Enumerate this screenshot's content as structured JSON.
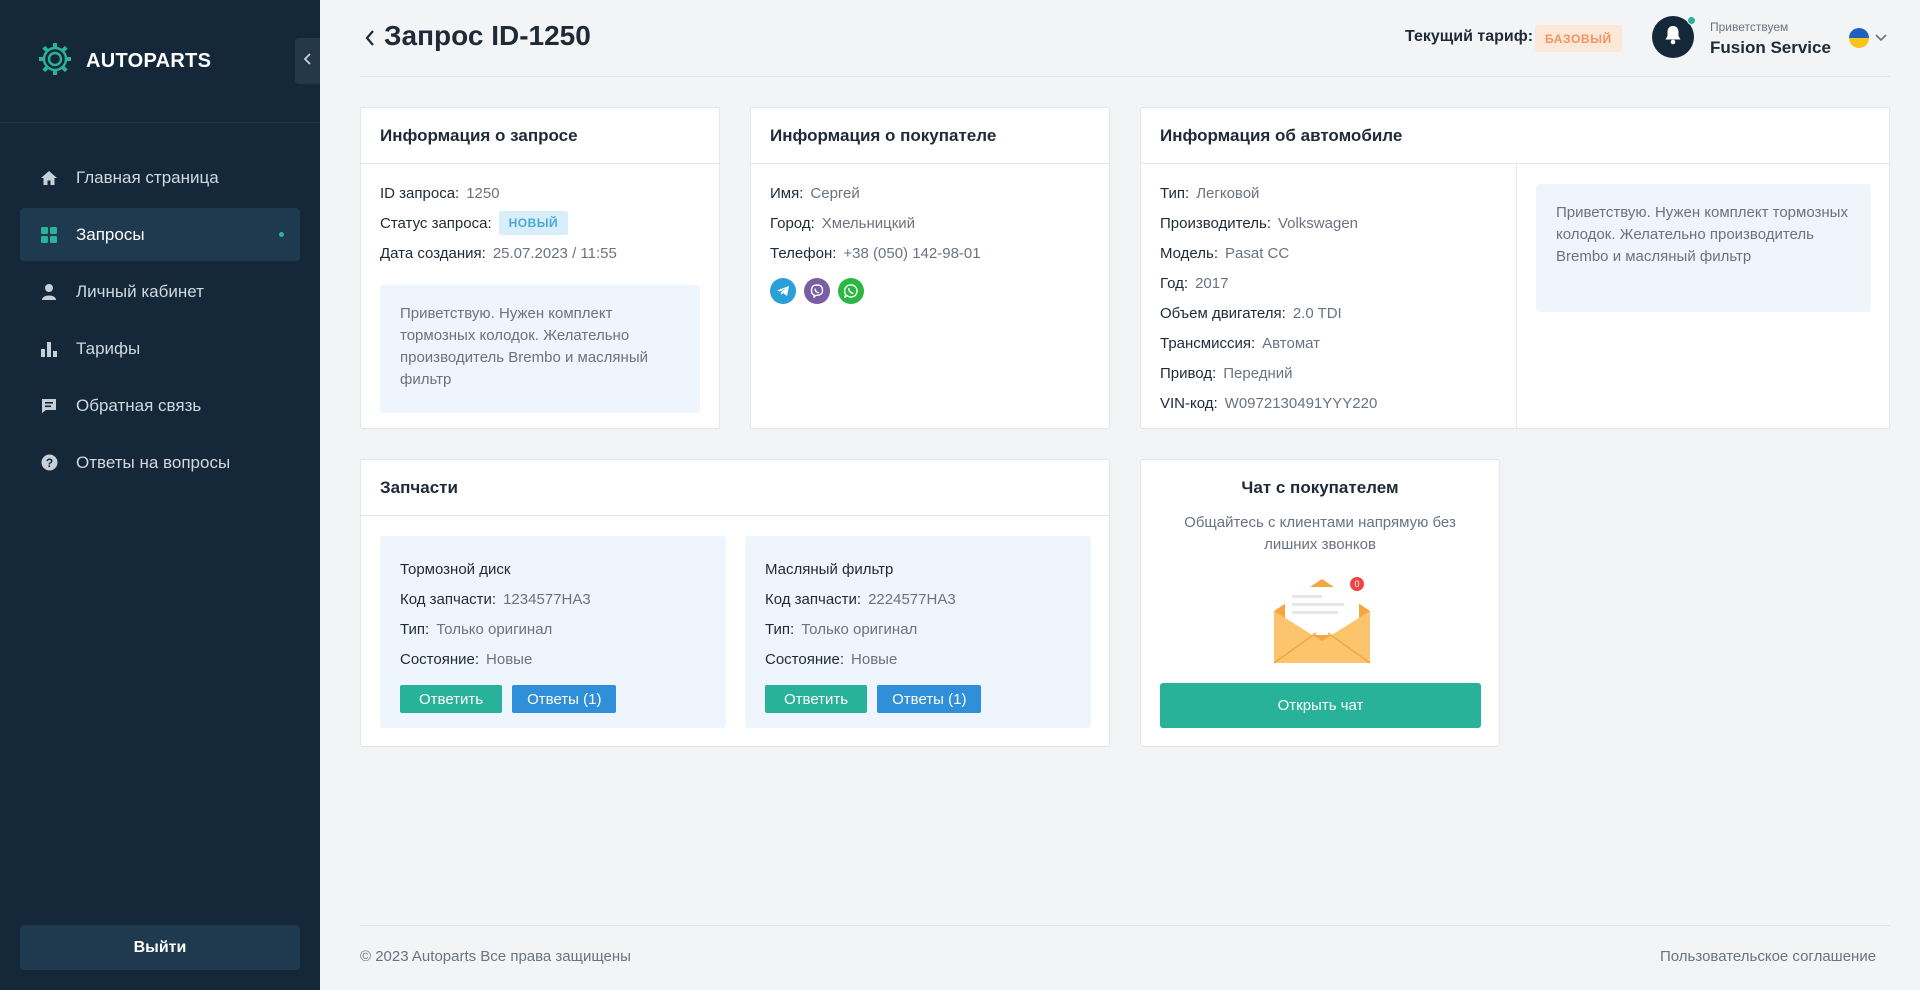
{
  "brand": {
    "name": "AUTOPARTS"
  },
  "sidebar": {
    "items": [
      {
        "label": "Главная страница",
        "icon": "home-icon"
      },
      {
        "label": "Запросы",
        "icon": "grid-icon",
        "active": true
      },
      {
        "label": "Личный кабинет",
        "icon": "user-icon"
      },
      {
        "label": "Тарифы",
        "icon": "bar-chart-icon"
      },
      {
        "label": "Обратная связь",
        "icon": "chat-icon"
      },
      {
        "label": "Ответы на вопросы",
        "icon": "question-icon"
      }
    ],
    "logout_label": "Выйти"
  },
  "header": {
    "title": "Запрос ID-1250",
    "tariff_label": "Текущий тариф:",
    "tariff_value": "БАЗОВЫЙ",
    "greeting": "Приветствуем",
    "user_name": "Fusion Service"
  },
  "request_info": {
    "title": "Информация о запросе",
    "id_label": "ID запроса:",
    "id_value": "1250",
    "status_label": "Статус запроса:",
    "status_value": "НОВЫЙ",
    "date_label": "Дата создания:",
    "date_value": "25.07.2023 / 11:55",
    "note": "Приветствую. Нужен комплект тормозных колодок. Желательно производитель Brembo и масляный фильтр"
  },
  "buyer_info": {
    "title": "Информация о покупателе",
    "name_label": "Имя:",
    "name_value": "Сергей",
    "city_label": "Город:",
    "city_value": "Хмельницкий",
    "phone_label": "Телефон:",
    "phone_value": "+38 (050) 142-98-01"
  },
  "car_info": {
    "title": "Информация об автомобиле",
    "rows": [
      {
        "label": "Тип:",
        "value": "Легковой"
      },
      {
        "label": "Производитель:",
        "value": "Volkswagen"
      },
      {
        "label": "Модель:",
        "value": "Pasat CC"
      },
      {
        "label": "Год:",
        "value": "2017"
      },
      {
        "label": "Объем двигателя:",
        "value": "2.0 TDI"
      },
      {
        "label": "Трансмиссия:",
        "value": "Автомат"
      },
      {
        "label": "Привод:",
        "value": "Передний"
      },
      {
        "label": "VIN-код:",
        "value": "W0972130491YYY220"
      }
    ],
    "note": "Приветствую. Нужен комплект тормозных колодок. Желательно производитель Brembo и масляный фильтр"
  },
  "parts": {
    "title": "Запчасти",
    "items": [
      {
        "name": "Тормозной диск",
        "code_label": "Код запчасти:",
        "code": "1234577HA3",
        "type_label": "Тип:",
        "type": "Только оригинал",
        "state_label": "Состояние:",
        "state": "Новые",
        "reply_label": "Ответить",
        "answers_label": "Ответы (1)"
      },
      {
        "name": "Масляный фильтр",
        "code_label": "Код запчасти:",
        "code": "2224577HA3",
        "type_label": "Тип:",
        "type": "Только оригинал",
        "state_label": "Состояние:",
        "state": "Новые",
        "reply_label": "Ответить",
        "answers_label": "Ответы (1)"
      }
    ]
  },
  "chat": {
    "title": "Чат с покупателем",
    "subtitle": "Общайтесь с клиентами напрямую без лишних звонков",
    "badge": "0",
    "open_label": "Открыть чат"
  },
  "footer": {
    "copyright": "© 2023 Autoparts Все права защищены",
    "terms": "Пользовательское соглашение"
  },
  "colors": {
    "sidebar": "#14283a",
    "accent": "#27b299",
    "blue": "#2f8fd8",
    "tariff": "#f59361"
  }
}
